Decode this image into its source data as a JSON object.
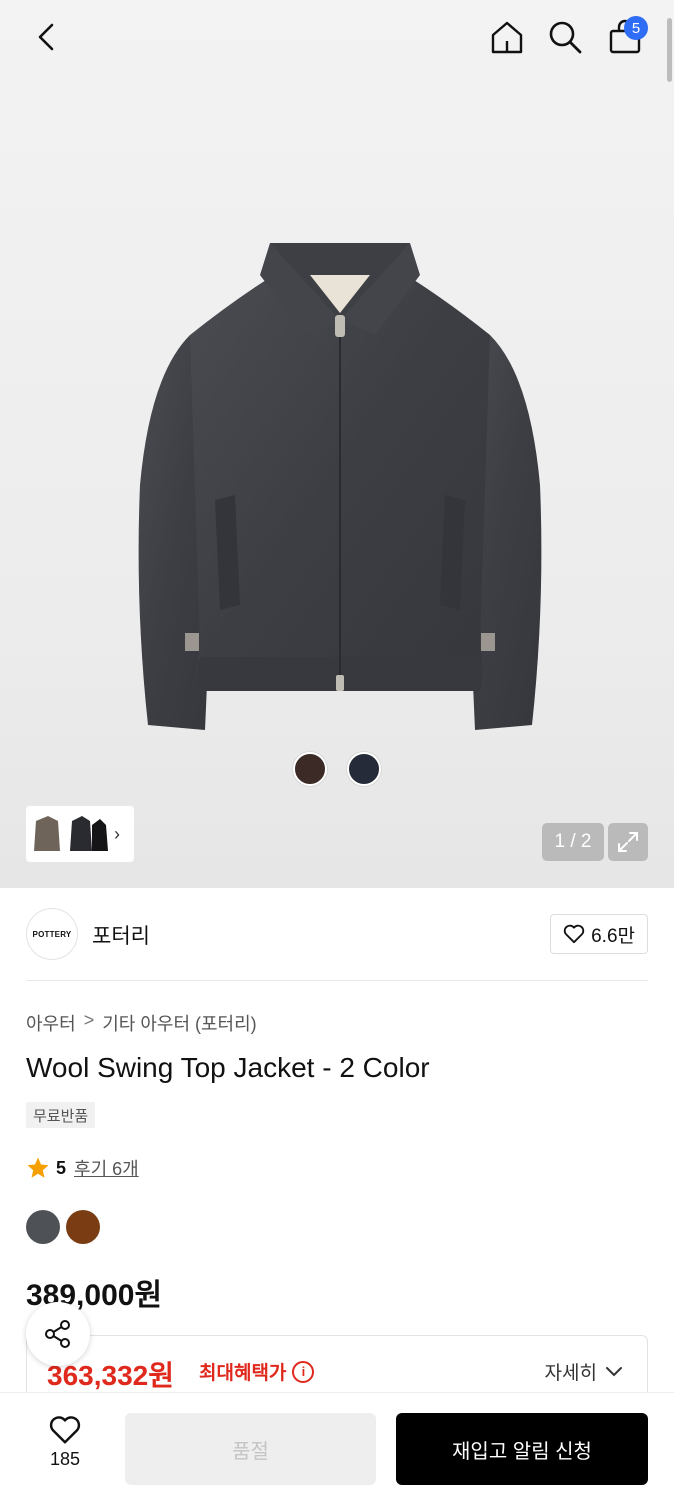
{
  "header": {
    "cart_count": "5"
  },
  "gallery": {
    "counter": "1 / 2",
    "swatch_colors": [
      "#3b2a25",
      "#252b38"
    ]
  },
  "brand": {
    "logo_text": "POTTERY",
    "name": "포터리",
    "likes": "6.6만"
  },
  "product": {
    "breadcrumb": [
      "아우터",
      ">",
      "기타 아우터 (포터리)"
    ],
    "title": "Wool Swing Top Jacket - 2 Color",
    "tag": "무료반품",
    "rating": "5",
    "review_link": "후기 6개",
    "colors": [
      "#4e5155",
      "#7a3c12"
    ],
    "price": "389,000원",
    "benefit_price": "363,332원",
    "benefit_label": "최대혜택가",
    "detail_label": "자세히"
  },
  "bottom": {
    "wish_count": "185",
    "soldout_label": "품절",
    "restock_label": "재입고 알림 신청"
  },
  "icons": [
    "back-icon",
    "home-icon",
    "search-icon",
    "cart-icon",
    "expand-icon",
    "heart-icon",
    "star-icon",
    "info-icon",
    "chevron-down-icon",
    "share-icon"
  ]
}
